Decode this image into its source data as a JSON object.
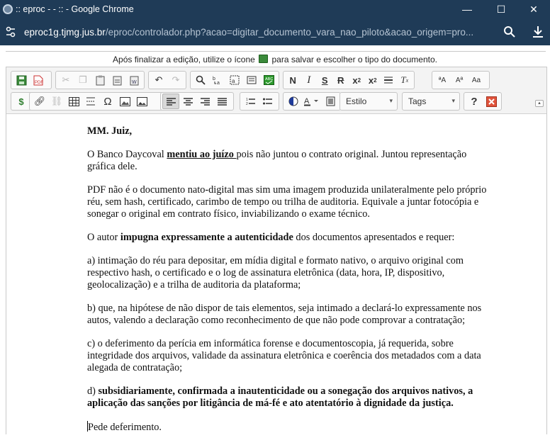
{
  "window": {
    "title": ":: eproc - - :: - Google Chrome",
    "minimize_symbol": "—",
    "maximize_symbol": "☐",
    "close_symbol": "✕"
  },
  "address": {
    "host": "eproc1g.tjmg.jus.br",
    "path": "/eproc/controlador.php?acao=digitar_documento_vara_nao_piloto&acao_origem=pro..."
  },
  "hint": {
    "before": "Após finalizar a edição, utilize o ícone",
    "after": "para salvar e escolher o tipo do documento."
  },
  "toolbar": {
    "style_label": "Estilo",
    "tags_label": "Tags",
    "help_label": "?",
    "dropdown_arrow": "▾"
  },
  "document": {
    "salutation": "MM. Juiz,",
    "p1_a": "O Banco Daycoval ",
    "p1_b": "mentiu ao juízo ",
    "p1_c": "pois não juntou o contrato original. Juntou representação gráfica dele.",
    "p2": "PDF não é o documento nato-digital mas sim uma imagem produzida unilateralmente pelo próprio réu, sem hash, certificado, carimbo de tempo ou trilha de auditoria. Equivale a juntar fotocópia e sonegar o original em contrato físico, inviabilizando o exame técnico.",
    "p3_a": "O autor ",
    "p3_b": "impugna expressamente a autenticidade",
    "p3_c": " dos documentos apresentados e requer:",
    "p4": "a) intimação do réu para depositar, em mídia digital e formato nativo, o arquivo original com respectivo hash, o certificado e o log de assinatura eletrônica (data, hora, IP, dispositivo, geolocalização) e a trilha de auditoria da plataforma;",
    "p5": "b) que, na hipótese de não dispor de tais elementos, seja intimado a declará-lo expressamente nos autos, valendo a declaração como reconhecimento de que não pode comprovar a contratação;",
    "p6": "c) o deferimento da perícia em informática forense e documentoscopia, já requerida, sobre integridade dos arquivos, validade da assinatura eletrônica e coerência dos metadados com a data alegada de contratação;",
    "p7_a": "d) ",
    "p7_b": "subsidiariamente, confirmada a inautenticidade ou a sonegação dos arquivos nativos, a aplicação das sanções por litigância de má-fé e ato atentatório à dignidade da justiça.",
    "closing": "Pede deferimento."
  }
}
